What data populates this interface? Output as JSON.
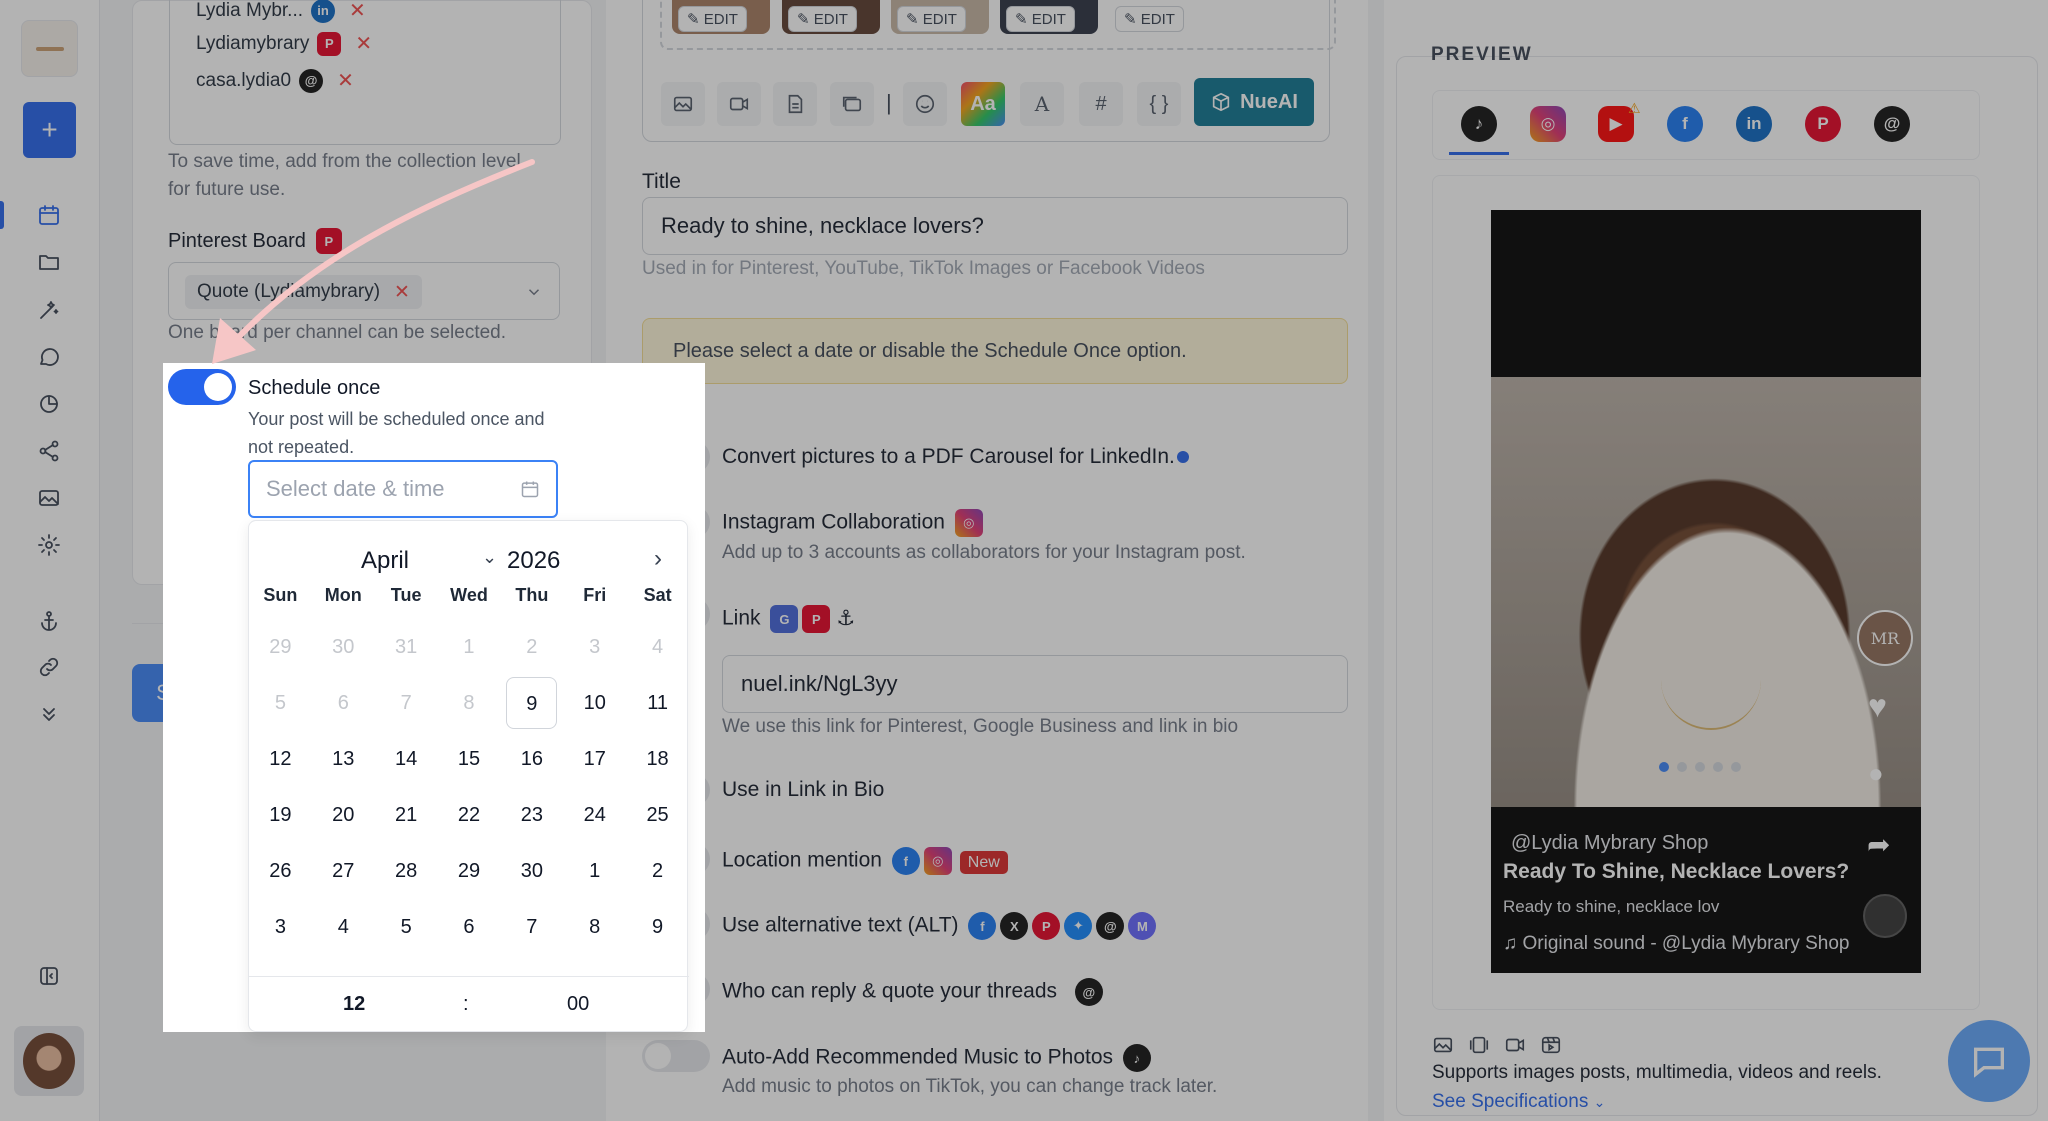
{
  "left": {
    "channels": [
      {
        "name": "Lydia Mybr...",
        "icon": "linkedin-icon",
        "badge": "in",
        "color": "#0a66c2"
      },
      {
        "name": "Lydiamybrary",
        "icon": "pinterest-icon",
        "badge": "P",
        "color": "#e60023"
      },
      {
        "name": "casa.lydia0",
        "icon": "threads-icon",
        "badge": "@",
        "color": "#111111"
      }
    ],
    "remove_glyph": "✕",
    "collection_hint": "To save time, add from the collection level for future use.",
    "pinterest_board_label": "Pinterest Board",
    "pinterest_board_value": "Quote (Lydiamybrary)",
    "pinterest_board_hint": "One board per channel can be selected.",
    "schedule_button": "Schedule"
  },
  "schedule": {
    "label": "Schedule once",
    "help": "Your post will be scheduled once and not repeated.",
    "placeholder": "Select date & time"
  },
  "calendar": {
    "month": "April",
    "year": "2026",
    "weekdays": [
      "Sun",
      "Mon",
      "Tue",
      "Wed",
      "Thu",
      "Fri",
      "Sat"
    ],
    "days": [
      {
        "d": "29",
        "out": true
      },
      {
        "d": "30",
        "out": true
      },
      {
        "d": "31",
        "out": true
      },
      {
        "d": "1",
        "out": true
      },
      {
        "d": "2",
        "out": true
      },
      {
        "d": "3",
        "out": true
      },
      {
        "d": "4",
        "out": true
      },
      {
        "d": "5",
        "out": true
      },
      {
        "d": "6",
        "out": true
      },
      {
        "d": "7",
        "out": true
      },
      {
        "d": "8",
        "out": true
      },
      {
        "d": "9",
        "today": true
      },
      {
        "d": "10"
      },
      {
        "d": "11"
      },
      {
        "d": "12"
      },
      {
        "d": "13"
      },
      {
        "d": "14"
      },
      {
        "d": "15"
      },
      {
        "d": "16"
      },
      {
        "d": "17"
      },
      {
        "d": "18"
      },
      {
        "d": "19"
      },
      {
        "d": "20"
      },
      {
        "d": "21"
      },
      {
        "d": "22"
      },
      {
        "d": "23"
      },
      {
        "d": "24"
      },
      {
        "d": "25"
      },
      {
        "d": "26"
      },
      {
        "d": "27"
      },
      {
        "d": "28"
      },
      {
        "d": "29"
      },
      {
        "d": "30"
      },
      {
        "d": "1"
      },
      {
        "d": "2"
      },
      {
        "d": "3"
      },
      {
        "d": "4"
      },
      {
        "d": "5"
      },
      {
        "d": "6"
      },
      {
        "d": "7"
      },
      {
        "d": "8"
      },
      {
        "d": "9"
      }
    ],
    "hour": "12",
    "sep": ":",
    "minute": "00"
  },
  "editor": {
    "edit_label": "EDIT",
    "nueai_label": "NueAI",
    "title_label": "Title",
    "title_value": "Ready to shine, necklace lovers?",
    "title_hint": "Used in for Pinterest, YouTube, TikTok Images or Facebook Videos",
    "warning": "Please select a date or disable the Schedule Once option.",
    "options": [
      {
        "label": "Convert pictures to a PDF Carousel for LinkedIn."
      },
      {
        "label": "Instagram Collaboration",
        "help": "Add up to 3 accounts as collaborators for your Instagram post."
      },
      {
        "label": "Link"
      },
      {
        "label": "Use in Link in Bio"
      },
      {
        "label": "Location mention",
        "badge": "New"
      },
      {
        "label": "Use alternative text (ALT)"
      },
      {
        "label": "Who can reply & quote your threads"
      },
      {
        "label": "Auto-Add Recommended Music to Photos",
        "help": "Add music to photos on TikTok, you can change track later."
      }
    ],
    "link_value": "nuel.ink/NgL3yy",
    "link_hint": "We use this link for Pinterest, Google Business and link in bio"
  },
  "preview": {
    "title": "PREVIEW",
    "platforms": [
      "tiktok-icon",
      "instagram-icon",
      "youtube-icon",
      "facebook-icon",
      "linkedin-icon",
      "pinterest-icon",
      "threads-icon"
    ],
    "account": "@Lydia Mybrary Shop",
    "post_title": "Ready To Shine, Necklace Lovers?",
    "caption": "Ready to shine, necklace lov",
    "sound": "Original sound - @Lydia Mybrary Shop",
    "supports": "Supports images posts, multimedia, videos and reels.",
    "see_specs": "See Specifications"
  },
  "colors": {
    "accent": "#2563eb",
    "nueai": "#0e7490",
    "warning_bg": "#fdf6d8",
    "warning_border": "#f3dc8f",
    "arrow": "#f6c6c6"
  }
}
